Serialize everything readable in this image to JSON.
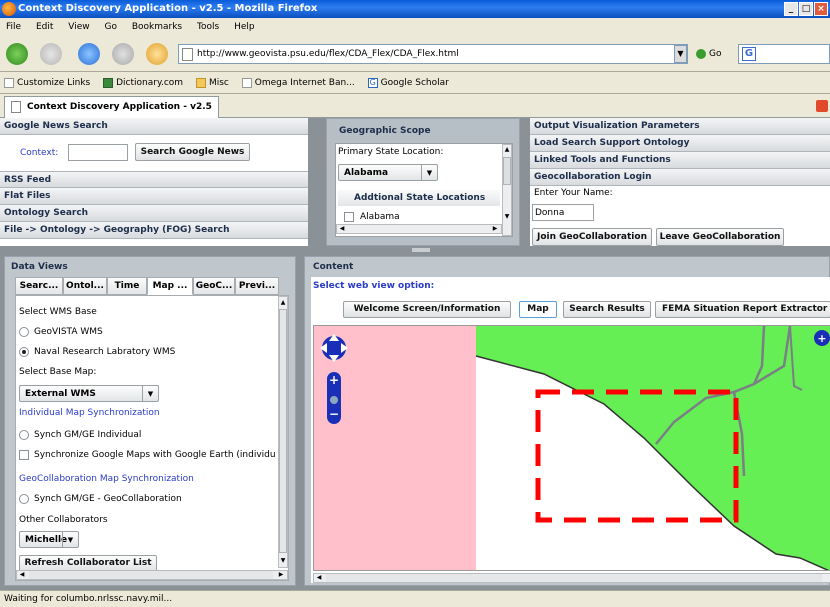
{
  "window": {
    "title": "Context Discovery Application - v2.5 - Mozilla Firefox",
    "controls": [
      "_",
      "□",
      "×"
    ]
  },
  "menu": [
    "File",
    "Edit",
    "View",
    "Go",
    "Bookmarks",
    "Tools",
    "Help"
  ],
  "nav": {
    "url": "http://www.geovista.psu.edu/flex/CDA_Flex/CDA_Flex.html",
    "go_label": "Go",
    "search_value": ""
  },
  "bookmarks": [
    "Customize Links",
    "Dictionary.com",
    "Misc",
    "Omega Internet Ban...",
    "Google Scholar"
  ],
  "tab": {
    "title": "Context Discovery Application - v2.5"
  },
  "left_top": {
    "title": "Google News Search",
    "context_label": "Context:",
    "context_value": "",
    "search_button": "Search Google News",
    "sections": [
      "RSS Feed",
      "Flat Files",
      "Ontology Search",
      "File -> Ontology -> Geography (FOG) Search"
    ]
  },
  "geo_scope": {
    "title": "Geographic Scope",
    "primary_label": "Primary State Location:",
    "primary_value": "Alabama",
    "additional_header": "Addtional State Locations",
    "additional_items": [
      "Alabama"
    ]
  },
  "right_top": {
    "sections": [
      "Output Visualization Parameters",
      "Load Search Support Ontology",
      "Linked Tools and Functions",
      "Geocollaboration Login"
    ],
    "name_label": "Enter Your Name:",
    "name_value": "Donna",
    "join_button": "Join GeoCollaboration",
    "leave_button": "Leave GeoCollaboration"
  },
  "data_views": {
    "title": "Data Views",
    "tabs": [
      "Searc...",
      "Ontol...",
      "Time",
      "Map ...",
      "GeoC...",
      "Previ..."
    ],
    "wms_label": "Select WMS Base",
    "wms_options": [
      "GeoVISTA WMS",
      "Naval Research Labratory WMS"
    ],
    "wms_selected": 1,
    "base_map_label": "Select Base Map:",
    "base_map_value": "External WMS",
    "individual_sync_label": "Individual Map Synchronization",
    "individual_option": "Synch GM/GE Individual",
    "sync_google_earth": "Synchronize Google Maps with Google Earth (individu",
    "geocollab_sync_label": "GeoCollaboration Map Synchronization",
    "geocollab_option": "Synch GM/GE - GeoCollaboration",
    "other_collab_label": "Other Collaborators",
    "collaborator_value": "Michelle",
    "refresh_button": "Refresh Collaborator List"
  },
  "content": {
    "title": "Content",
    "web_view_label": "Select web view option:",
    "view_buttons": [
      "Welcome Screen/Information",
      "Map",
      "Search Results",
      "FEMA Situation Report Extractor (FE"
    ],
    "map_colors": {
      "water": "#ffc0cb",
      "land": "#66ee55",
      "road": "#7a7f86",
      "highlight": "#ff0000"
    }
  },
  "status": {
    "text": "Waiting for columbo.nrlssc.navy.mil..."
  }
}
